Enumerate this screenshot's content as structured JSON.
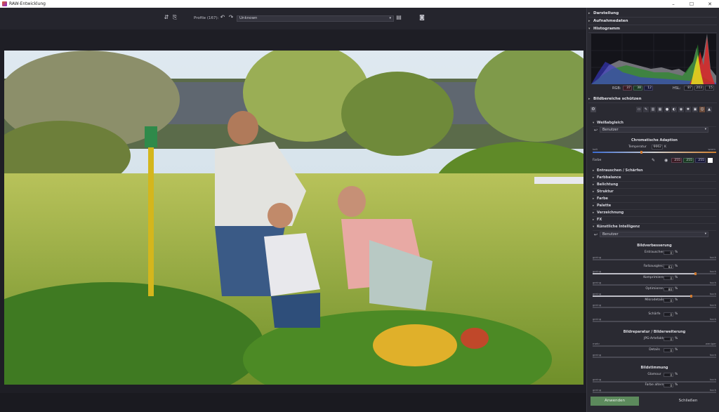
{
  "window": {
    "title": "RAW-Entwicklung",
    "buttons": {
      "minimize": "–",
      "maximize": "☐",
      "close": "✕"
    }
  },
  "toolbar": {
    "profile_label": "Profile (167):",
    "profile_value": "Unknown"
  },
  "sidebar": {
    "sections": {
      "darstellung": "Darstellung",
      "aufnahmedaten": "Aufnahmedaten",
      "histogramm": "Histogramm",
      "bildbereiche": "Bildbereiche schützen"
    },
    "histogram": {
      "rgb_label": "RGB:",
      "rgb_values": [
        "37",
        "38",
        "12"
      ],
      "hsl_label": "HSL:",
      "hsl_values": [
        "87",
        "203",
        "15"
      ]
    },
    "weissabgleich": {
      "title": "Weißabgleich",
      "preset": "Benutzer",
      "chromatic_title": "Chromatische Adaption",
      "temp_label": "Temperatur",
      "temp_value": "6662",
      "temp_unit": "K",
      "cold": "kalt",
      "warm": "warm",
      "farbe_label": "Farbe",
      "farbe_values": [
        "255",
        "255",
        "255"
      ]
    },
    "subsections": [
      "Entrauschen / Schärfen",
      "Farbbalance",
      "Belichtung",
      "Struktur",
      "Farbe",
      "Palette",
      "Verzeichnung",
      "FX",
      "Künstliche Intelligenz"
    ],
    "ki": {
      "preset": "Benutzer",
      "bildverbesserung": "Bildverbesserung",
      "bildreparatur": "Bildreparatur / Bilderweiterung",
      "bildstimmung": "Bildstimmung"
    },
    "sliders": [
      {
        "label": "Entrauschen",
        "value": "0",
        "unit": "%",
        "lo": "gering",
        "hi": "hoch",
        "level": 0
      },
      {
        "label": "Farbausgleich",
        "value": "83",
        "unit": "%",
        "lo": "gering",
        "hi": "hoch",
        "level": 0.83
      },
      {
        "label": "Komprimieren",
        "value": "0",
        "unit": "%",
        "lo": "gering",
        "hi": "hoch",
        "level": 0
      },
      {
        "label": "Optimieren",
        "value": "80",
        "unit": "%",
        "lo": "gering",
        "hi": "hoch",
        "level": 0.8
      },
      {
        "label": "Mikrodetails",
        "value": "0",
        "unit": "%",
        "lo": "gering",
        "hi": "hoch",
        "level": 0
      },
      {
        "label": "Schärfe",
        "value": "0",
        "unit": "%",
        "lo": "gering",
        "hi": "hoch",
        "level": 0
      },
      {
        "label": "JPG-Artefakte",
        "value": "0",
        "unit": "%",
        "lo": "mehr",
        "hi": "weniger",
        "level": 0
      },
      {
        "label": "Details",
        "value": "0",
        "unit": "%",
        "lo": "gering",
        "hi": "hoch",
        "level": 0
      },
      {
        "label": "Glamour",
        "value": "0",
        "unit": "%",
        "lo": "gering",
        "hi": "hoch",
        "level": 0
      },
      {
        "label": "Farbe altern",
        "value": "0",
        "unit": "%",
        "lo": "gering",
        "hi": "hoch",
        "level": 0
      }
    ],
    "apply_label": "Anwenden",
    "close_label": "Schließen"
  },
  "colors": {
    "accent": "#d07a30",
    "apply_button": "#5c8a5c",
    "panel_bg": "#2a2a32"
  }
}
